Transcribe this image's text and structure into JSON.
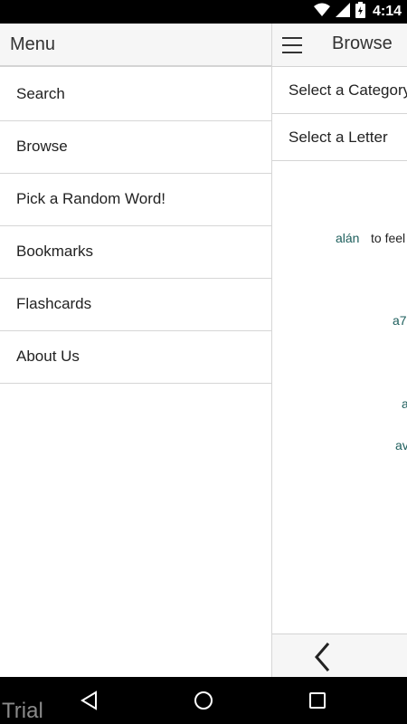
{
  "status_bar": {
    "time": "4:14",
    "icons": [
      "wifi-icon",
      "signal-icon",
      "battery-icon"
    ]
  },
  "drawer": {
    "title": "Menu",
    "items": [
      {
        "label": "Search"
      },
      {
        "label": "Browse"
      },
      {
        "label": "Pick a Random Word!"
      },
      {
        "label": "Bookmarks"
      },
      {
        "label": "Flashcards"
      },
      {
        "label": "About Us"
      }
    ]
  },
  "app": {
    "title": "Browse",
    "select_category": "Select a Category",
    "select_letter": "Select a Letter",
    "entries": [
      {
        "word": "alán",
        "definition": "to feel"
      },
      {
        "word": "a7",
        "definition": ""
      },
      {
        "word": "a",
        "definition": ""
      },
      {
        "word": "av",
        "definition": ""
      }
    ]
  },
  "nav_bar": {
    "watermark": "Trial",
    "buttons": [
      "back-icon",
      "home-icon",
      "recents-icon"
    ]
  },
  "colors": {
    "accent_word": "#1d5e5c",
    "header_bg": "#f6f6f6",
    "divider": "#d6d6d6"
  }
}
